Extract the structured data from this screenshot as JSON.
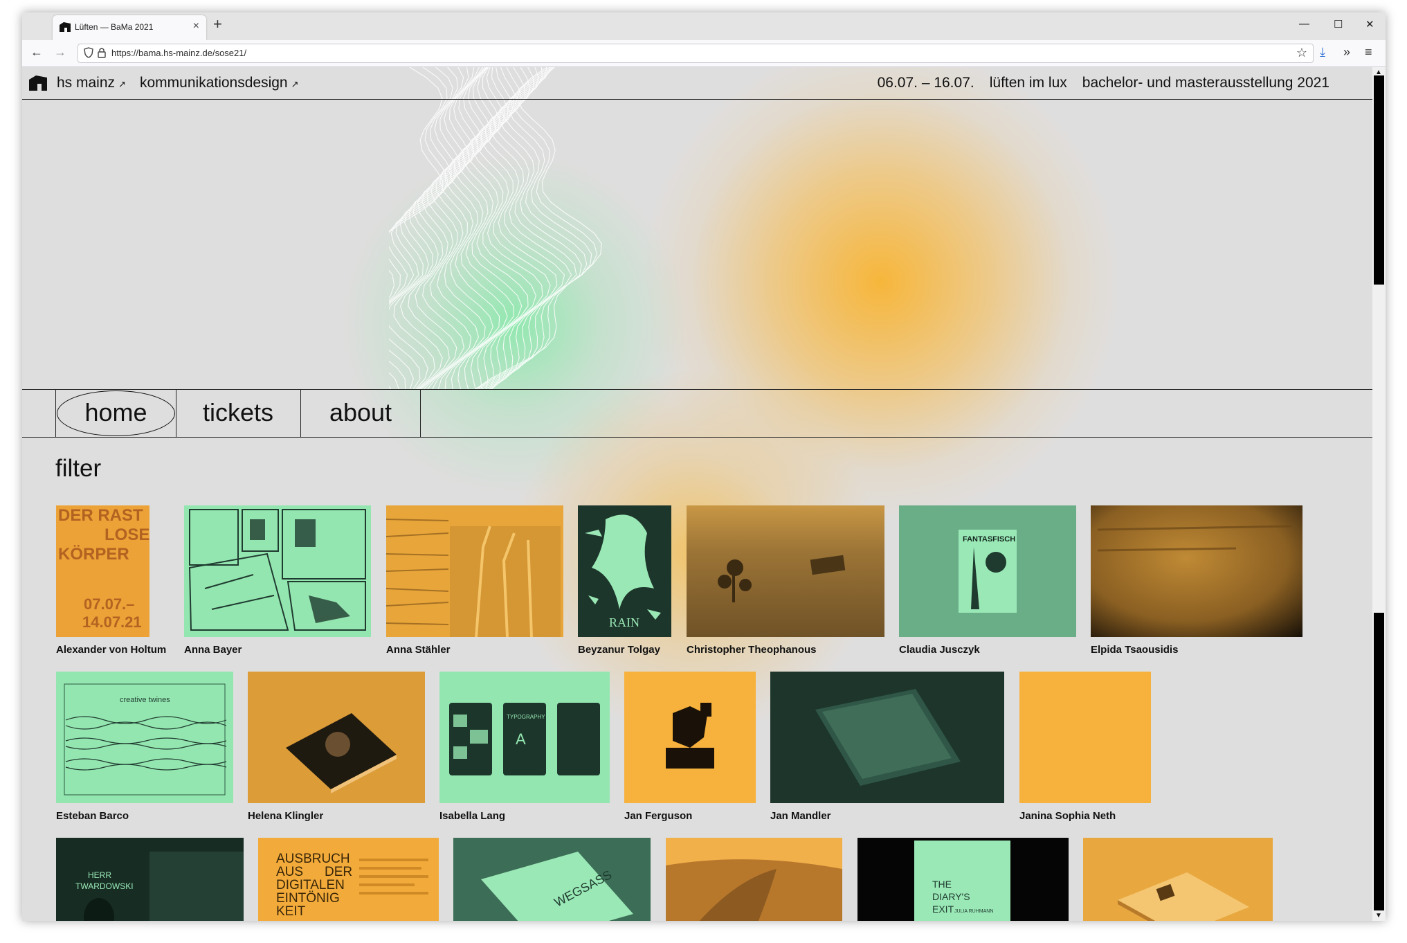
{
  "browser": {
    "tab_title": "Lüften — BaMa 2021",
    "tab_close": "×",
    "new_tab": "+",
    "url": "https://bama.hs-mainz.de/sose21/",
    "window_controls": [
      "—",
      "☐",
      "✕"
    ],
    "nav_back": "←",
    "nav_forward": "→",
    "bookmark_icon": "☆",
    "download_icon": "⤓",
    "overflow_icon": "»",
    "menu_icon": "≡"
  },
  "header": {
    "left_links": [
      {
        "label": "hs mainz",
        "arrow": "↗"
      },
      {
        "label": "kommunikationsdesign",
        "arrow": "↗"
      }
    ],
    "dates": "06.07. – 16.07.",
    "event": "lüften im lux",
    "title": "bachelor- und masterausstellung 2021"
  },
  "nav": {
    "home": "home",
    "tickets": "tickets",
    "about": "about"
  },
  "filter_heading": "filter",
  "thumb_texts": {
    "poster_lines": [
      "DER RAST",
      "LOSE",
      "KÖRPER",
      "07.07.–",
      "14.07.21"
    ],
    "rain": "RAIN",
    "fantasfisch": "FANTASFISCH",
    "creative_twines": "creative twines",
    "typography": "TYPOGRAPHY",
    "typography_letter": "A",
    "herr": "HERR",
    "twardowski": "TWARDOWSKI",
    "ausbruch_lines": [
      "AUSBRUCH",
      "AUS",
      "DER",
      "DIGITALEN",
      "EINTÖNIG",
      "KEIT"
    ],
    "diary_lines": [
      "THE",
      "DIARY'S",
      "EXIT"
    ],
    "diary_author": "JULIA RUHMANN",
    "wegsass": "WEGSASS"
  },
  "projects": [
    {
      "name": "Alexander von Holtum"
    },
    {
      "name": "Anna Bayer"
    },
    {
      "name": "Anna Stähler"
    },
    {
      "name": "Beyzanur Tolgay"
    },
    {
      "name": "Christopher Theophanous"
    },
    {
      "name": "Claudia Jusczyk"
    },
    {
      "name": "Elpida Tsaousidis"
    },
    {
      "name": "Esteban Barco"
    },
    {
      "name": "Helena Klingler"
    },
    {
      "name": "Isabella Lang"
    },
    {
      "name": "Jan Ferguson"
    },
    {
      "name": "Jan Mandler"
    },
    {
      "name": "Janina Sophia Neth"
    }
  ],
  "colors": {
    "background": "#dfdede",
    "orange": "#f2ab3b",
    "mint": "#94e6b0",
    "dark_green": "#1f3b30",
    "sea_green": "#6aae88"
  }
}
